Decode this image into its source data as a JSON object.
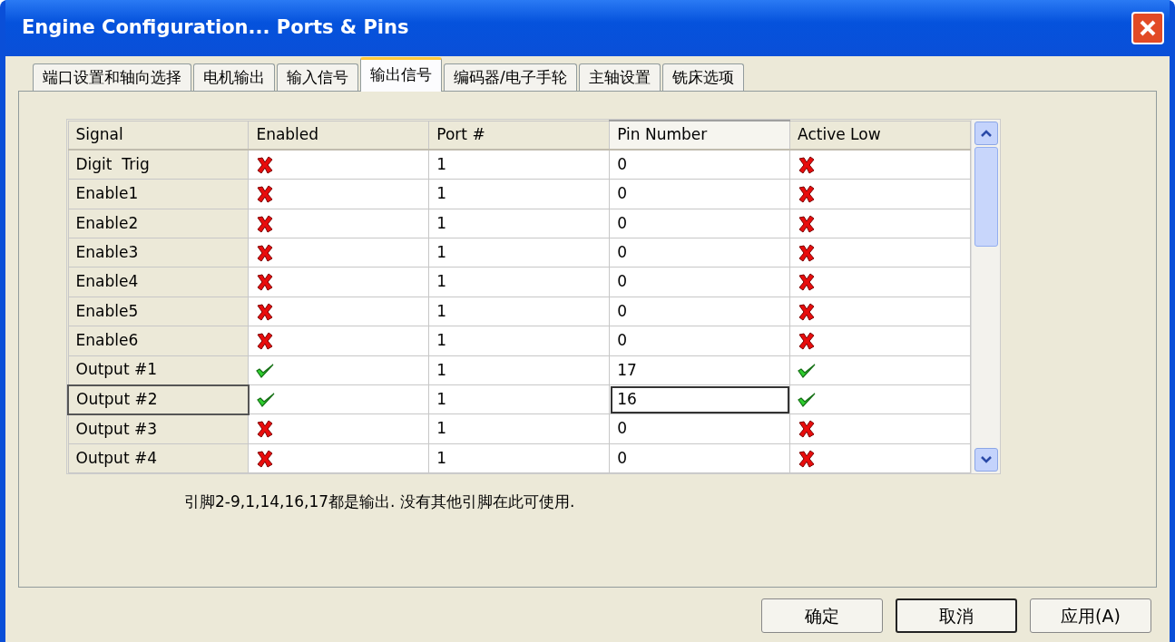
{
  "window": {
    "title": "Engine Configuration... Ports & Pins"
  },
  "tabs": [
    {
      "label": "端口设置和轴向选择",
      "selected": false
    },
    {
      "label": "电机输出",
      "selected": false
    },
    {
      "label": "输入信号",
      "selected": false
    },
    {
      "label": "输出信号",
      "selected": true
    },
    {
      "label": "编码器/电子手轮",
      "selected": false
    },
    {
      "label": "主轴设置",
      "selected": false
    },
    {
      "label": "铣床选项",
      "selected": false
    }
  ],
  "table": {
    "columns": [
      {
        "label": "Signal",
        "selected": false
      },
      {
        "label": "Enabled",
        "selected": false
      },
      {
        "label": "Port #",
        "selected": false
      },
      {
        "label": "Pin Number",
        "selected": true
      },
      {
        "label": "Active Low",
        "selected": false
      }
    ],
    "rows": [
      {
        "signal": "Digit  Trig",
        "enabled": false,
        "port": "1",
        "pin": "0",
        "active_low": false,
        "selected": false
      },
      {
        "signal": "Enable1",
        "enabled": false,
        "port": "1",
        "pin": "0",
        "active_low": false,
        "selected": false
      },
      {
        "signal": "Enable2",
        "enabled": false,
        "port": "1",
        "pin": "0",
        "active_low": false,
        "selected": false
      },
      {
        "signal": "Enable3",
        "enabled": false,
        "port": "1",
        "pin": "0",
        "active_low": false,
        "selected": false
      },
      {
        "signal": "Enable4",
        "enabled": false,
        "port": "1",
        "pin": "0",
        "active_low": false,
        "selected": false
      },
      {
        "signal": "Enable5",
        "enabled": false,
        "port": "1",
        "pin": "0",
        "active_low": false,
        "selected": false
      },
      {
        "signal": "Enable6",
        "enabled": false,
        "port": "1",
        "pin": "0",
        "active_low": false,
        "selected": false
      },
      {
        "signal": "Output #1",
        "enabled": true,
        "port": "1",
        "pin": "17",
        "active_low": true,
        "selected": false
      },
      {
        "signal": "Output #2",
        "enabled": true,
        "port": "1",
        "pin": "16",
        "active_low": true,
        "selected": true
      },
      {
        "signal": "Output #3",
        "enabled": false,
        "port": "1",
        "pin": "0",
        "active_low": false,
        "selected": false
      },
      {
        "signal": "Output #4",
        "enabled": false,
        "port": "1",
        "pin": "0",
        "active_low": false,
        "selected": false
      }
    ]
  },
  "note": "引脚2-9,1,14,16,17都是输出. 没有其他引脚在此可使用.",
  "buttons": [
    {
      "label": "确定",
      "default": false
    },
    {
      "label": "取消",
      "default": true
    },
    {
      "label": "应用(A)",
      "default": false
    }
  ]
}
